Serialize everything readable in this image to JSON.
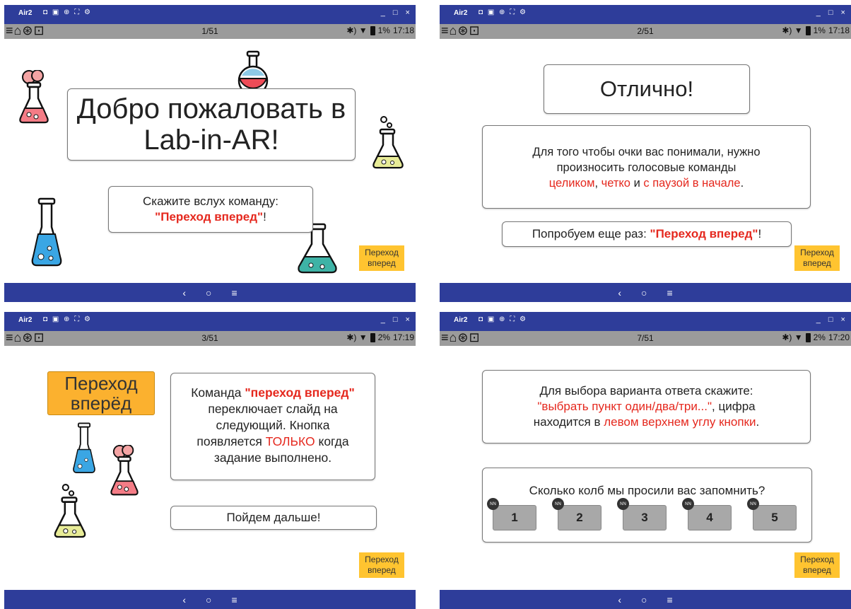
{
  "window": {
    "title": "Air2",
    "controls": "_ □ ×",
    "title_icons": "◘ ▣ ⊕ ⛶ ⚙"
  },
  "status": {
    "left_icons": "≡⌂⊛⊡",
    "signal": "✱) ▼",
    "p1_batt": "1%",
    "p1_time": "17:18",
    "p2_batt": "1%",
    "p2_time": "17:18",
    "p3_batt": "2%",
    "p3_time": "17:19",
    "p4_batt": "2%",
    "p4_time": "17:20"
  },
  "nav": {
    "back": "‹",
    "home": "○",
    "menu": "≡"
  },
  "forward_button": {
    "line1": "Переход",
    "line2": "вперед"
  },
  "slide1": {
    "counter": "1/51",
    "title_line1": "Добро пожаловать в",
    "title_line2": "Lab-in-AR!",
    "prompt": "Скажите вслух команду:",
    "command": "\"Переход вперед\"",
    "command_suffix": "!"
  },
  "slide2": {
    "counter": "2/51",
    "title": "Отлично!",
    "body_line1": "Для того чтобы очки вас понимали, нужно",
    "body_line2": "произносить голосовые команды",
    "body_red1": "целиком",
    "body_sep1": ", ",
    "body_red2": "четко",
    "body_sep2": " и ",
    "body_red3": "с паузой в начале",
    "body_end": ".",
    "retry_prefix": "Попробуем еще раз: ",
    "retry_command": "\"Переход вперед\"",
    "retry_suffix": "!"
  },
  "slide3": {
    "counter": "3/51",
    "big_button_line1": "Переход",
    "big_button_line2": "вперёд",
    "text_a": "Команда ",
    "text_red1": "\"переход вперед\"",
    "text_b": "переключает слайд на",
    "text_c": "следующий. Кнопка",
    "text_d": "появляется ",
    "text_red2": "ТОЛЬКО",
    "text_e": " когда",
    "text_f": "задание выполнено.",
    "next": "Пойдем дальше!"
  },
  "slide4": {
    "counter": "7/51",
    "instr_line1": "Для выбора варианта ответа скажите:",
    "instr_red1": "\"выбрать пункт один/два/три...\"",
    "instr_mid": ", цифра",
    "instr_line3a": "находится в ",
    "instr_red2": "левом верхнем углу кнопки",
    "instr_end": ".",
    "question": "Сколько колб мы просили вас запомнить?",
    "badge": "NN",
    "options": [
      "1",
      "2",
      "3",
      "4",
      "5"
    ]
  },
  "colors": {
    "titlebar": "#2e3d9a",
    "statusbar": "#9b9b9b",
    "accent_red": "#e5281e",
    "button_yellow": "#ffc430"
  }
}
